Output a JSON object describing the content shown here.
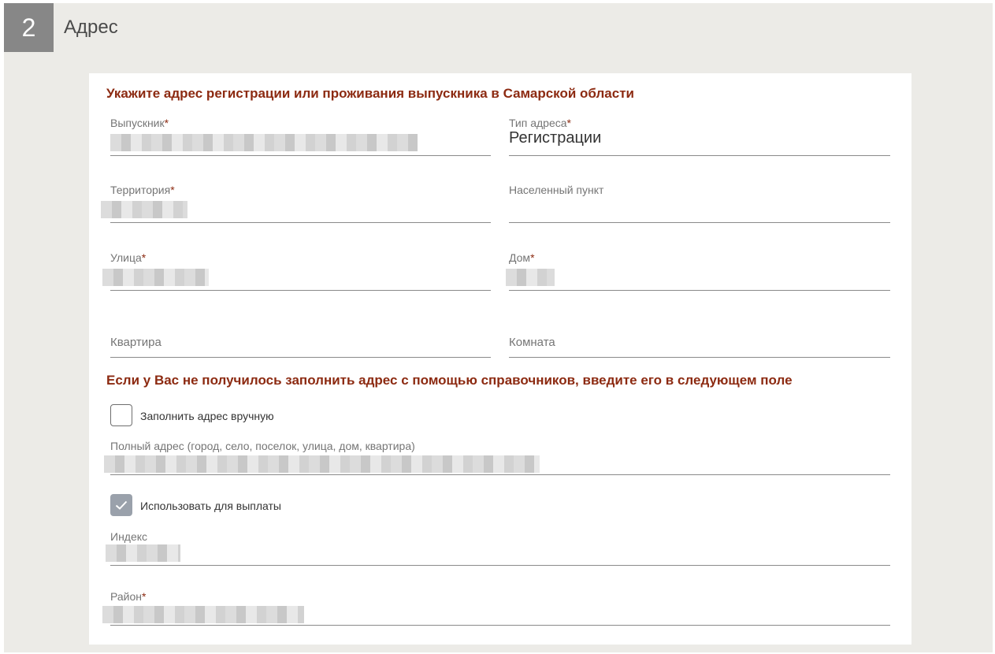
{
  "section": {
    "number": "2",
    "title": "Адрес"
  },
  "heading_main": "Укажите адрес регистрации или проживания выпускника в Самарской области",
  "fields": {
    "graduate": {
      "label": "Выпускник",
      "required": "*"
    },
    "address_type": {
      "label": "Тип адреса",
      "required": "*",
      "value": "Регистрации"
    },
    "territory": {
      "label": "Территория",
      "required": "*"
    },
    "locality": {
      "label": "Населенный пункт"
    },
    "street": {
      "label": "Улица",
      "required": "*"
    },
    "house": {
      "label": "Дом",
      "required": "*"
    },
    "apartment": {
      "label": "Квартира"
    },
    "room": {
      "label": "Комната"
    }
  },
  "heading_manual": "Если у Вас не получилось заполнить адрес с помощью справочников, введите его в следующем поле",
  "manual_checkbox": {
    "label": "Заполнить адрес вручную",
    "checked": false
  },
  "full_address": {
    "label": "Полный адрес (город, село, поселок, улица, дом, квартира)"
  },
  "payment_checkbox": {
    "label": "Использовать для выплаты",
    "checked": true
  },
  "index_field": {
    "label": "Индекс"
  },
  "district_field": {
    "label": "Район",
    "required": "*"
  },
  "colors": {
    "accent": "#8c2a11",
    "badge": "#878787",
    "background": "#ecebe7"
  }
}
